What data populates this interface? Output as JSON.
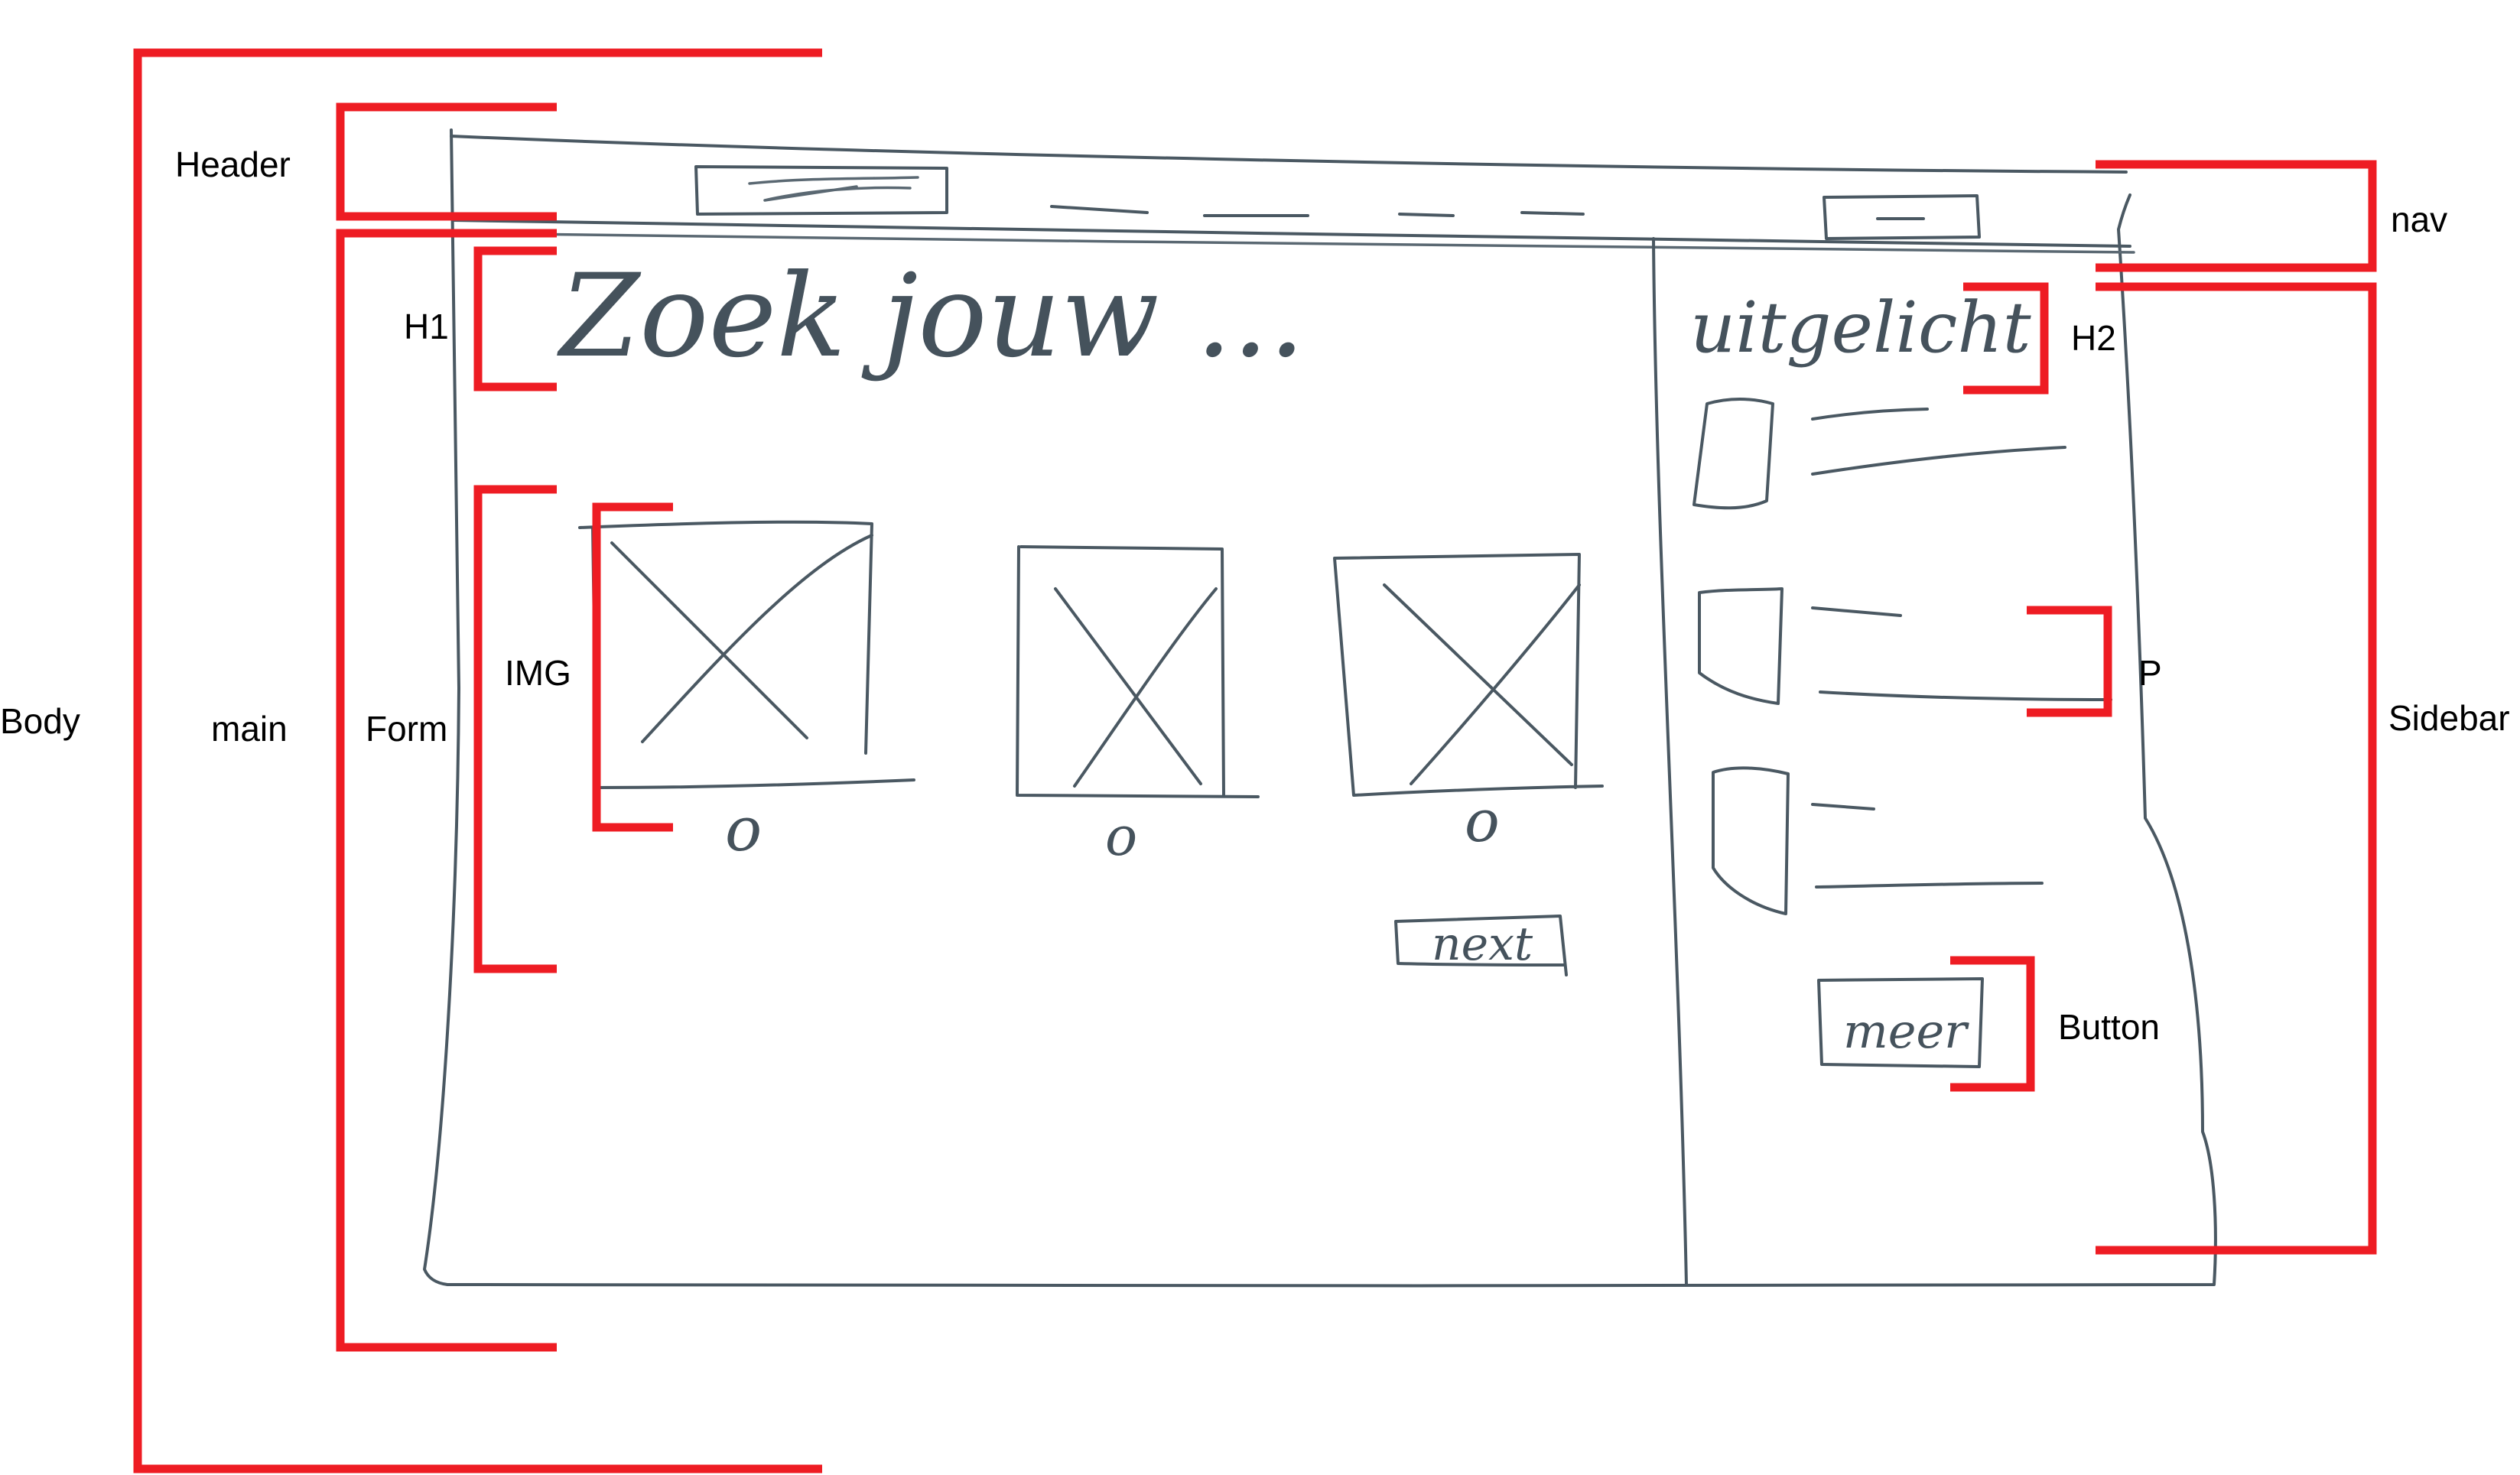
{
  "labels": {
    "header": "Header",
    "nav": "nav",
    "h1": "H1",
    "h2": "H2",
    "body": "Body",
    "main": "main",
    "form": "Form",
    "img": "IMG",
    "p": "P",
    "sidebar": "Sidebar",
    "button": "Button"
  },
  "sketch": {
    "heading": "Zoek jouw ...",
    "sidebar_heading": "uitgelicht",
    "next_button": "next",
    "more_button": "meer",
    "radio_mark": "o"
  },
  "colors": {
    "annotation": "#ee1c23",
    "sketch_ink": "#4a5862",
    "background": "#ffffff"
  }
}
